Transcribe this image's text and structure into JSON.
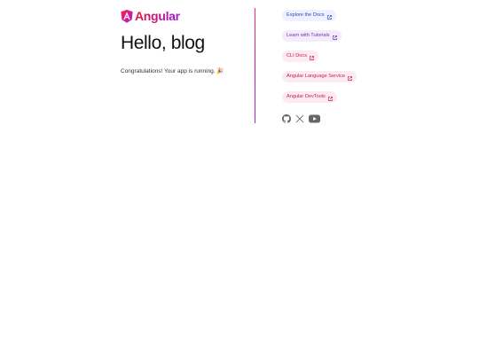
{
  "brand": {
    "name": "Angular",
    "accent_colors": [
      "#e8163d",
      "#c2148c",
      "#9b1bd9"
    ]
  },
  "hero": {
    "title": "Hello, blog",
    "subtitle": "Congratulations! Your app is running. 🎉"
  },
  "links": [
    {
      "label": "Explore the Docs",
      "icon": "external-link-icon"
    },
    {
      "label": "Learn with Tutorials",
      "icon": "external-link-icon"
    },
    {
      "label": "CLI Docs",
      "icon": "external-link-icon"
    },
    {
      "label": "Angular Language Service",
      "icon": "external-link-icon"
    },
    {
      "label": "Angular DevTools",
      "icon": "external-link-icon"
    }
  ],
  "social": [
    {
      "name": "github-icon"
    },
    {
      "name": "x-twitter-icon"
    },
    {
      "name": "youtube-icon"
    }
  ]
}
